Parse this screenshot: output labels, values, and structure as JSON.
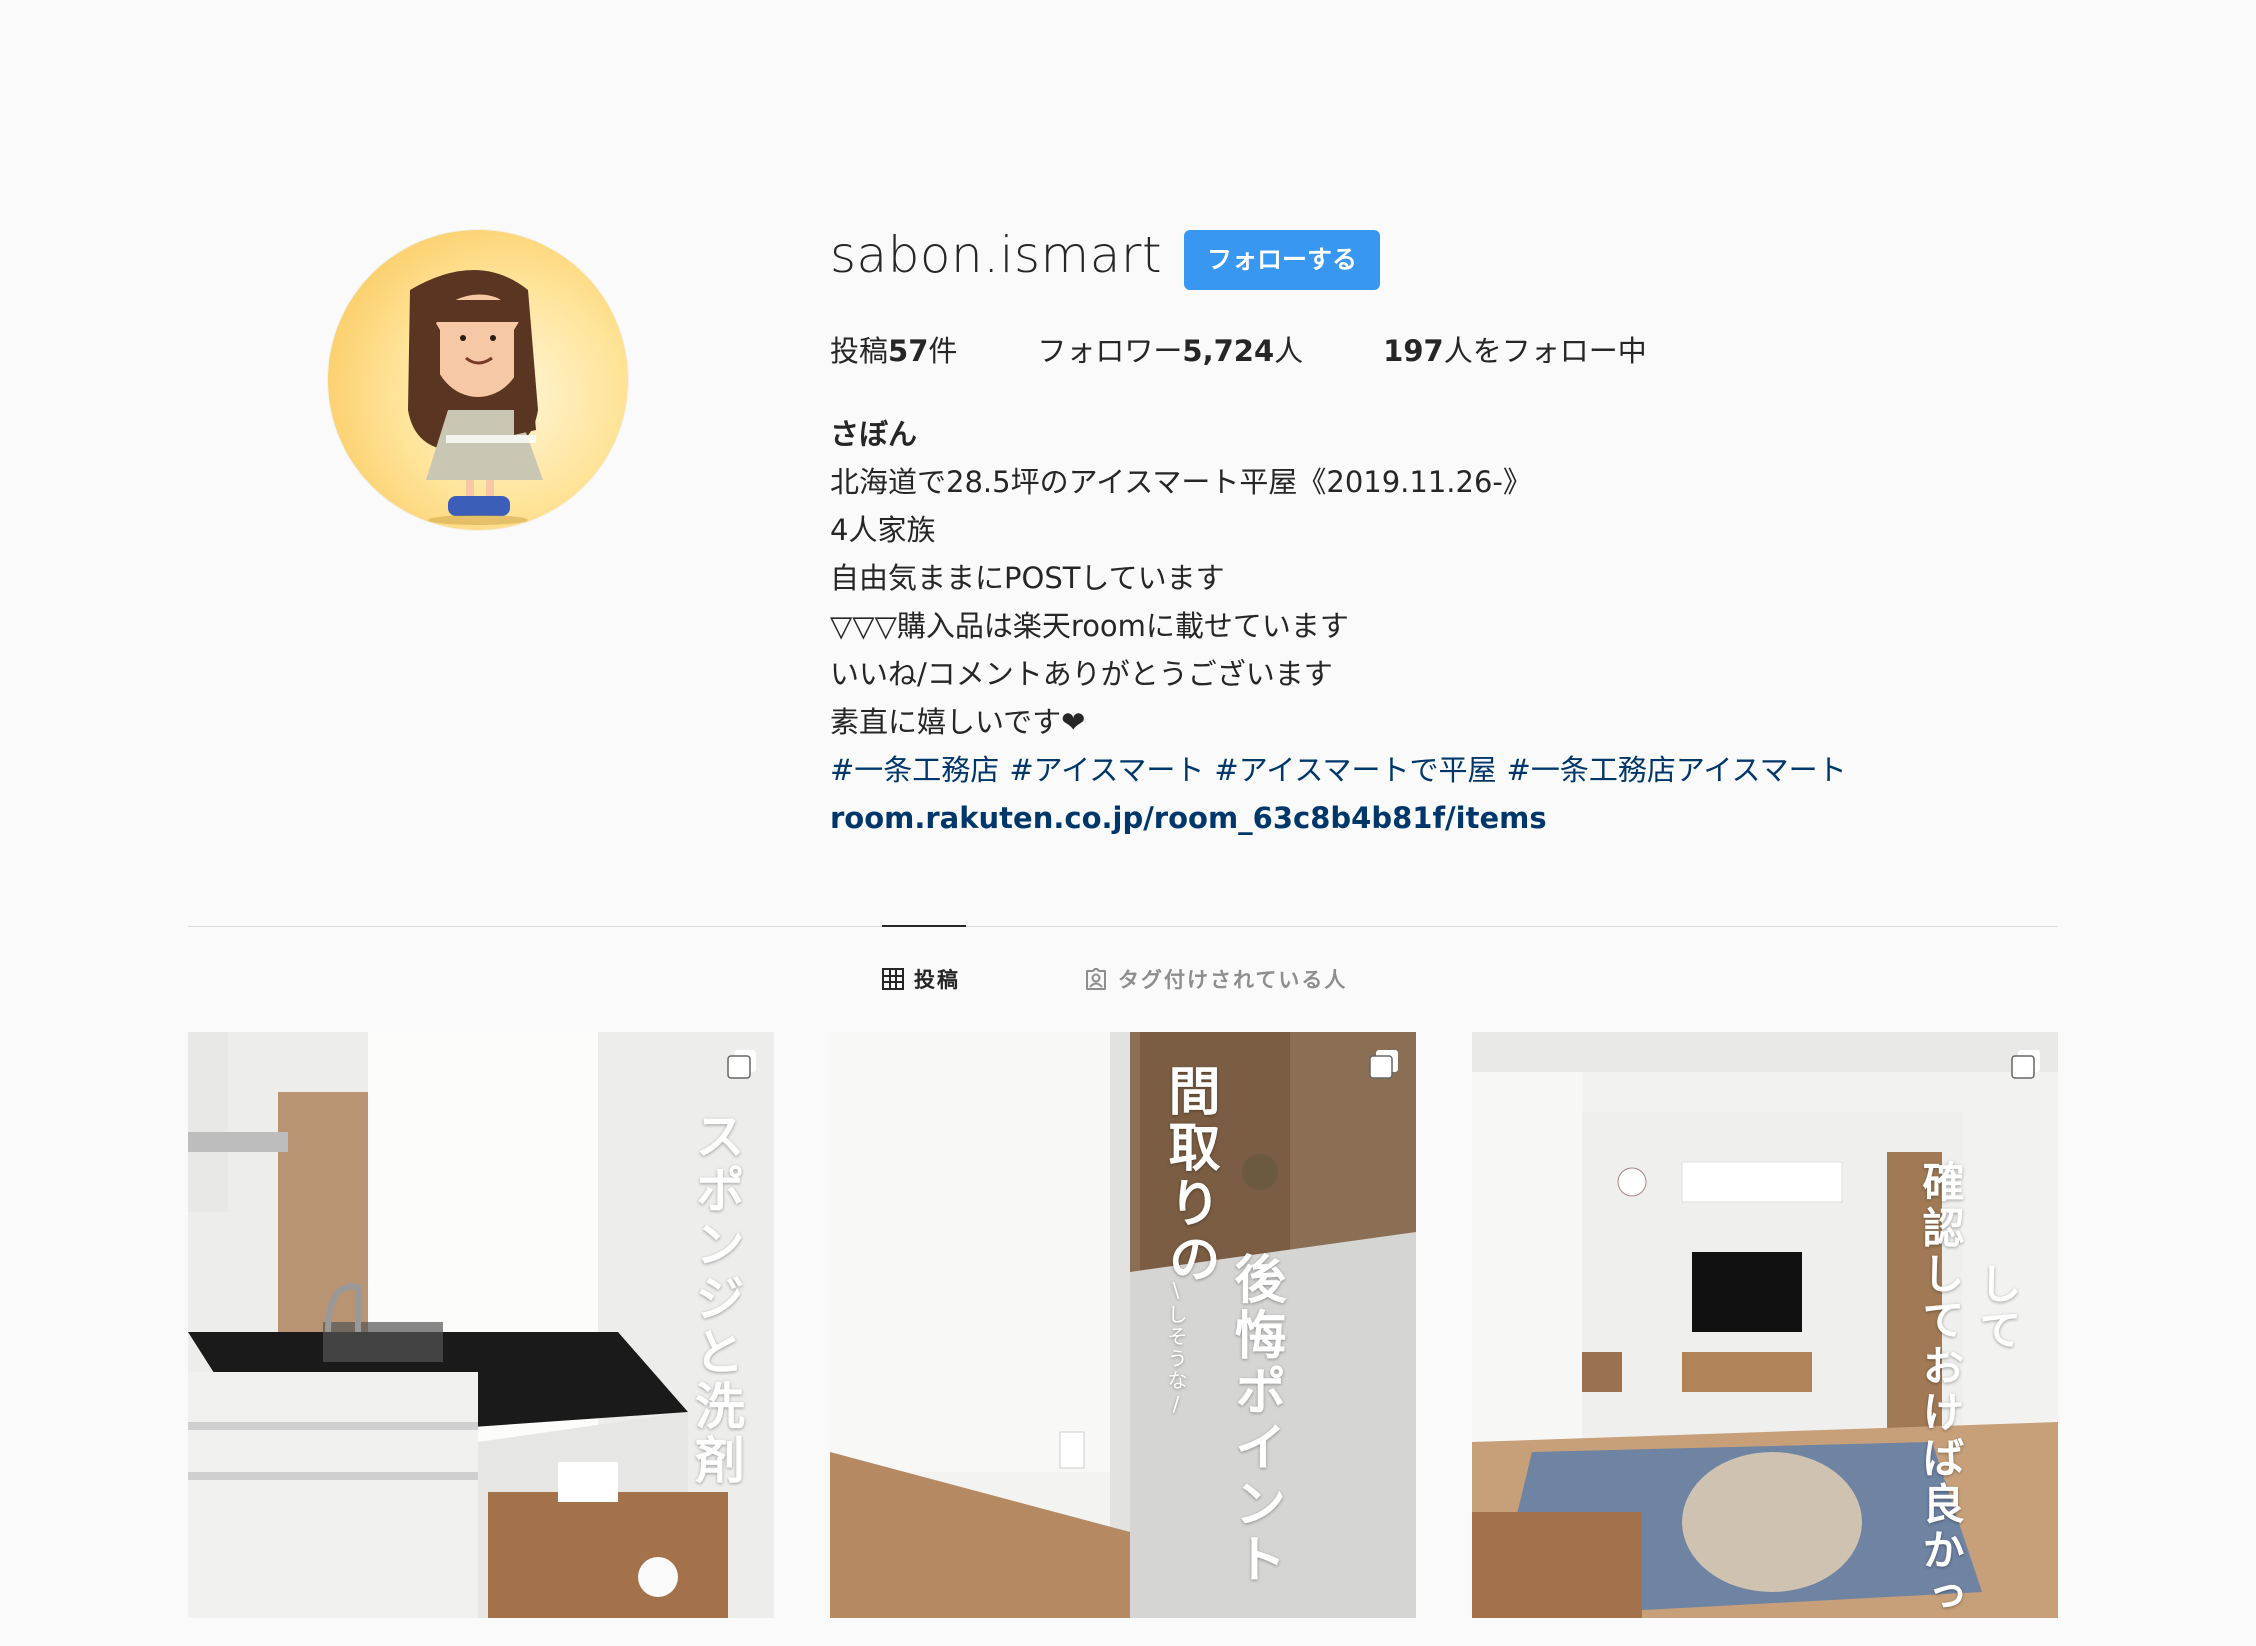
{
  "profile": {
    "username": "sabon.ismart",
    "follow_button": "フォローする",
    "avatar": "avatar-character"
  },
  "stats": {
    "posts_prefix": "投稿",
    "posts_count": "57",
    "posts_suffix": "件",
    "followers_prefix": "フォロワー",
    "followers_count": "5,724",
    "followers_suffix": "人",
    "following_count": "197",
    "following_suffix": "人をフォロー中"
  },
  "bio": {
    "name": "さぼん",
    "lines": [
      "北海道で28.5坪のアイスマート平屋《2019.11.26-》",
      "4人家族",
      "自由気ままにPOSTしています",
      "▽▽▽購入品は楽天roomに載せています",
      "いいね/コメントありがとうございます",
      "素直に嬉しいです❤"
    ],
    "hashtags": [
      "#一条工務店",
      "#アイスマート",
      "#アイスマートで平屋",
      "#一条工務店アイスマート"
    ],
    "link": "room.rakuten.co.jp/room_63c8b4b81f/items"
  },
  "tabs": {
    "posts": "投稿",
    "tagged": "タグ付けされている人"
  },
  "posts": [
    {
      "caption": "スポンジと洗剤",
      "type_icon": "multi-photo-icon"
    },
    {
      "caption_1": "間取りの",
      "caption_2": "後悔ポイント",
      "caption_small": "\\しそうな/",
      "type_icon": "multi-photo-icon"
    },
    {
      "caption_1": "して",
      "caption_2": "確認しておけば良かったこ",
      "type_icon": "multi-photo-icon"
    }
  ],
  "colors": {
    "follow_blue": "#3897f0",
    "link_blue": "#00376b",
    "background": "#fafafa"
  }
}
